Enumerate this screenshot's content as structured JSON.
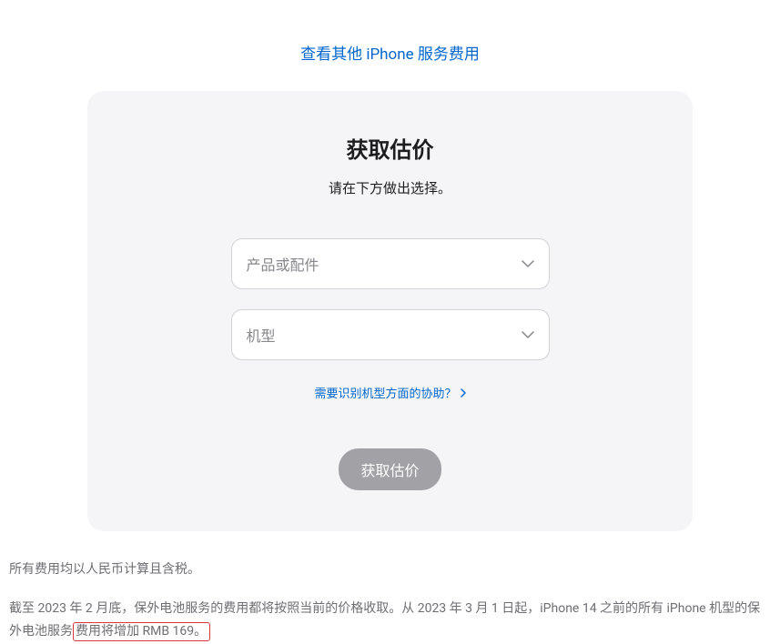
{
  "topLink": {
    "label": "查看其他 iPhone 服务费用"
  },
  "card": {
    "title": "获取估价",
    "subtitle": "请在下方做出选择。",
    "select1": {
      "placeholder": "产品或配件"
    },
    "select2": {
      "placeholder": "机型"
    },
    "helpLink": {
      "label": "需要识别机型方面的协助？"
    },
    "submitButton": {
      "label": "获取估价"
    }
  },
  "footer": {
    "line1": "所有费用均以人民币计算且含税。",
    "line2_part1": "截至 2023 年 2 月底，保外电池服务的费用都将按照当前的价格收取。从 2023 年 3 月 1 日起，iPhone 14 之前的所有 iPhone 机型的保外电池服务",
    "line2_highlight": "费用将增加 RMB 169。"
  }
}
